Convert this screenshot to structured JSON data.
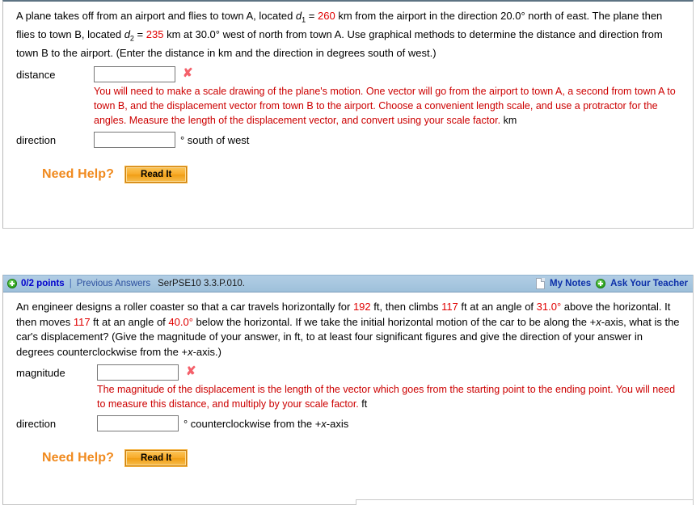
{
  "questions": [
    {
      "id": "question-1",
      "has_status_bar": false,
      "prompt_segments": [
        {
          "t": "A plane takes off from an airport and flies to town A, located ",
          "k": "plain"
        },
        {
          "t": "d",
          "k": "ital"
        },
        {
          "t": "1",
          "k": "sub"
        },
        {
          "t": " = ",
          "k": "plain"
        },
        {
          "t": "260",
          "k": "num"
        },
        {
          "t": " km from the airport in the direction 20.0° north of east. The plane then flies to town B, located ",
          "k": "plain"
        },
        {
          "t": "d",
          "k": "ital"
        },
        {
          "t": "2",
          "k": "sub"
        },
        {
          "t": " = ",
          "k": "plain"
        },
        {
          "t": "235",
          "k": "num"
        },
        {
          "t": " km at 30.0° west of north from town A. Use graphical methods to determine the distance and direction from town B to the airport. (Enter the distance in km and the direction in degrees south of west.)",
          "k": "plain"
        }
      ],
      "answers": [
        {
          "label": "distance",
          "value": "",
          "placeholder": "",
          "mark": "✘",
          "mark_state": "incorrect",
          "unit_after": "",
          "feedback": "You will need to make a scale drawing of the plane's motion. One vector will go from the airport to town A, a second from town A to town B, and the displacement vector from town B to the airport. Choose a convenient length scale, and use a protractor for the angles. Measure the length of the displacement vector, and convert using your scale factor.",
          "feedback_unit": "km"
        },
        {
          "label": "direction",
          "value": "",
          "placeholder": "",
          "mark": "",
          "mark_state": "none",
          "unit_after": "° south of west",
          "feedback": "",
          "feedback_unit": ""
        }
      ],
      "need_help": {
        "label": "Need Help?",
        "button_label": "Read It"
      }
    },
    {
      "id": "question-2",
      "has_status_bar": true,
      "status_bar": {
        "points": "0/2 points",
        "divider": "|",
        "previous_answers": "Previous Answers",
        "question_code": "SerPSE10 3.3.P.010.",
        "my_notes": "My Notes",
        "ask_your_teacher": "Ask Your Teacher",
        "plus_icon": "plus-circle-icon",
        "notes_icon": "page-icon"
      },
      "prompt_segments": [
        {
          "t": "An engineer designs a roller coaster so that a car travels horizontally for ",
          "k": "plain"
        },
        {
          "t": "192",
          "k": "num"
        },
        {
          "t": " ft, then climbs ",
          "k": "plain"
        },
        {
          "t": "117",
          "k": "num"
        },
        {
          "t": " ft at an angle of ",
          "k": "plain"
        },
        {
          "t": "31.0°",
          "k": "num"
        },
        {
          "t": " above the horizontal. It then moves ",
          "k": "plain"
        },
        {
          "t": "117",
          "k": "num"
        },
        {
          "t": " ft at an angle of ",
          "k": "plain"
        },
        {
          "t": "40.0°",
          "k": "num"
        },
        {
          "t": " below the horizontal. If we take the initial horizontal motion of the car to be along the +",
          "k": "plain"
        },
        {
          "t": "x",
          "k": "ital"
        },
        {
          "t": "-axis, what is the car's displacement? (Give the magnitude of your answer, in ft, to at least four significant figures and give the direction of your answer in degrees counterclockwise from the +",
          "k": "plain"
        },
        {
          "t": "x",
          "k": "ital"
        },
        {
          "t": "-axis.)",
          "k": "plain"
        }
      ],
      "answers": [
        {
          "label": "magnitude",
          "value": "",
          "placeholder": "",
          "mark": "✘",
          "mark_state": "incorrect",
          "unit_after": "",
          "feedback": "The magnitude of the displacement is the length of the vector which goes from the starting point to the ending point. You will need to measure this distance, and multiply by your scale factor.",
          "feedback_unit": "ft"
        },
        {
          "label": "direction",
          "value": "",
          "placeholder": "",
          "mark": "",
          "mark_state": "none",
          "unit_after": "° counterclockwise from the +x-axis",
          "unit_after_segments": [
            {
              "t": "° counterclockwise from the +",
              "k": "plain"
            },
            {
              "t": "x",
              "k": "ital"
            },
            {
              "t": "-axis",
              "k": "plain"
            }
          ],
          "feedback": "",
          "feedback_unit": ""
        }
      ],
      "need_help": {
        "label": "Need Help?",
        "button_label": "Read It"
      }
    }
  ],
  "colors": {
    "accent_orange": "#f08a1e",
    "feedback_red": "#cc0000",
    "number_red": "#e00000",
    "status_bar_blue": "#a8c7e0",
    "link_blue": "#0b2fa8",
    "incorrect_mark": "#f4606a"
  }
}
